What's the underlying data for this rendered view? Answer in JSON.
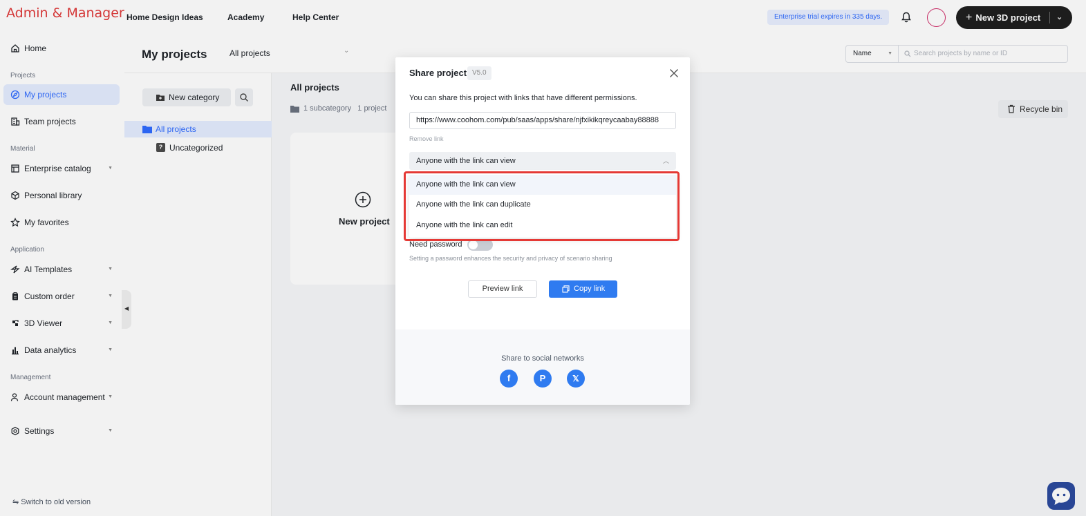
{
  "brand": "Admin & Manager",
  "topnav": [
    "Home Design Ideas",
    "Academy",
    "Help Center"
  ],
  "trial_notice": "Enterprise trial expires in 335 days.",
  "new_project_button": "New 3D project",
  "sidebar": {
    "home": "Home",
    "sections": {
      "projects": "Projects",
      "material": "Material",
      "application": "Application",
      "management": "Management"
    },
    "items": {
      "my_projects": "My projects",
      "team_projects": "Team projects",
      "enterprise_catalog": "Enterprise catalog",
      "personal_library": "Personal library",
      "my_favorites": "My favorites",
      "ai_templates": "AI Templates",
      "custom_order": "Custom order",
      "viewer_3d": "3D Viewer",
      "data_analytics": "Data analytics",
      "account_management": "Account management",
      "settings": "Settings"
    },
    "switch_old": "Switch to old version"
  },
  "main": {
    "title": "My projects",
    "filter": "All projects",
    "sort": "Name",
    "search_placeholder": "Search projects by name or ID",
    "new_category": "New category",
    "categories": {
      "all": "All projects",
      "uncategorized": "Uncategorized"
    },
    "content_title": "All projects",
    "content_meta": "1 subcategory   1 project",
    "recycle_bin": "Recycle bin",
    "new_project_card": "New project"
  },
  "modal": {
    "title": "Share project",
    "version": "V5.0",
    "description": "You can share this project with links that have different permissions.",
    "url": "https://www.coohom.com/pub/saas/apps/share/njfxikikqreycaabay88888",
    "remove_link": "Remove link",
    "selected_permission": "Anyone with the link can view",
    "permission_options": [
      "Anyone with the link can view",
      "Anyone with the link can duplicate",
      "Anyone with the link can edit"
    ],
    "need_password": "Need password",
    "password_hint": "Setting a password enhances the security and privacy of scenario sharing",
    "preview_link": "Preview link",
    "copy_link": "Copy link",
    "share_social": "Share to social networks",
    "social": {
      "facebook": "f",
      "pinterest": "P",
      "x": "𝕏"
    }
  },
  "colors": {
    "accent": "#2f7bf0",
    "highlight": "#e53935",
    "brand_text": "#e03a3a"
  }
}
